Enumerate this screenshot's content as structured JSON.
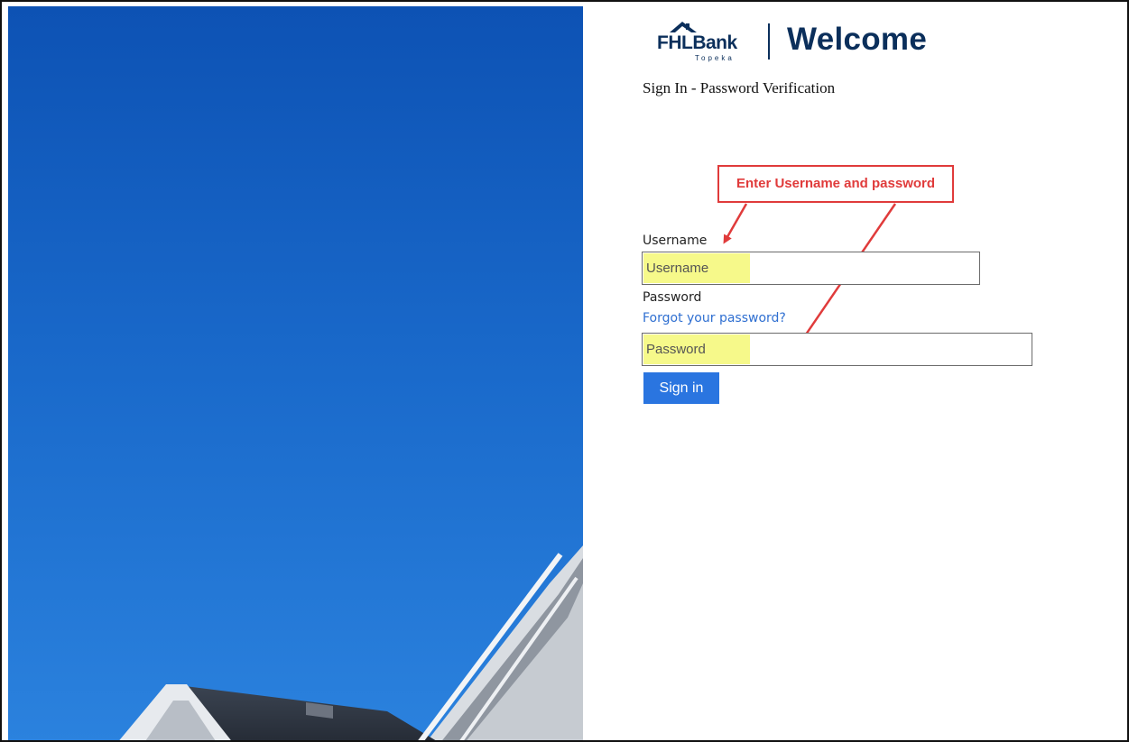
{
  "header": {
    "logo_text": "FHLBank",
    "logo_subtext": "Topeka",
    "welcome": "Welcome"
  },
  "form": {
    "subtitle": "Sign In - Password Verification",
    "username_label": "Username",
    "username_placeholder": "Username",
    "password_label": "Password",
    "forgot_link": "Forgot your password?",
    "password_placeholder": "Password",
    "signin_label": "Sign in"
  },
  "annotation": {
    "callout_text": "Enter Username and password",
    "color": "#e03b3b"
  },
  "colors": {
    "brand_navy": "#0b2f5b",
    "button_blue": "#2a75e0",
    "link_blue": "#2f6fd1",
    "highlight": "#f6f98a",
    "sky_blue": "#1766c7"
  }
}
